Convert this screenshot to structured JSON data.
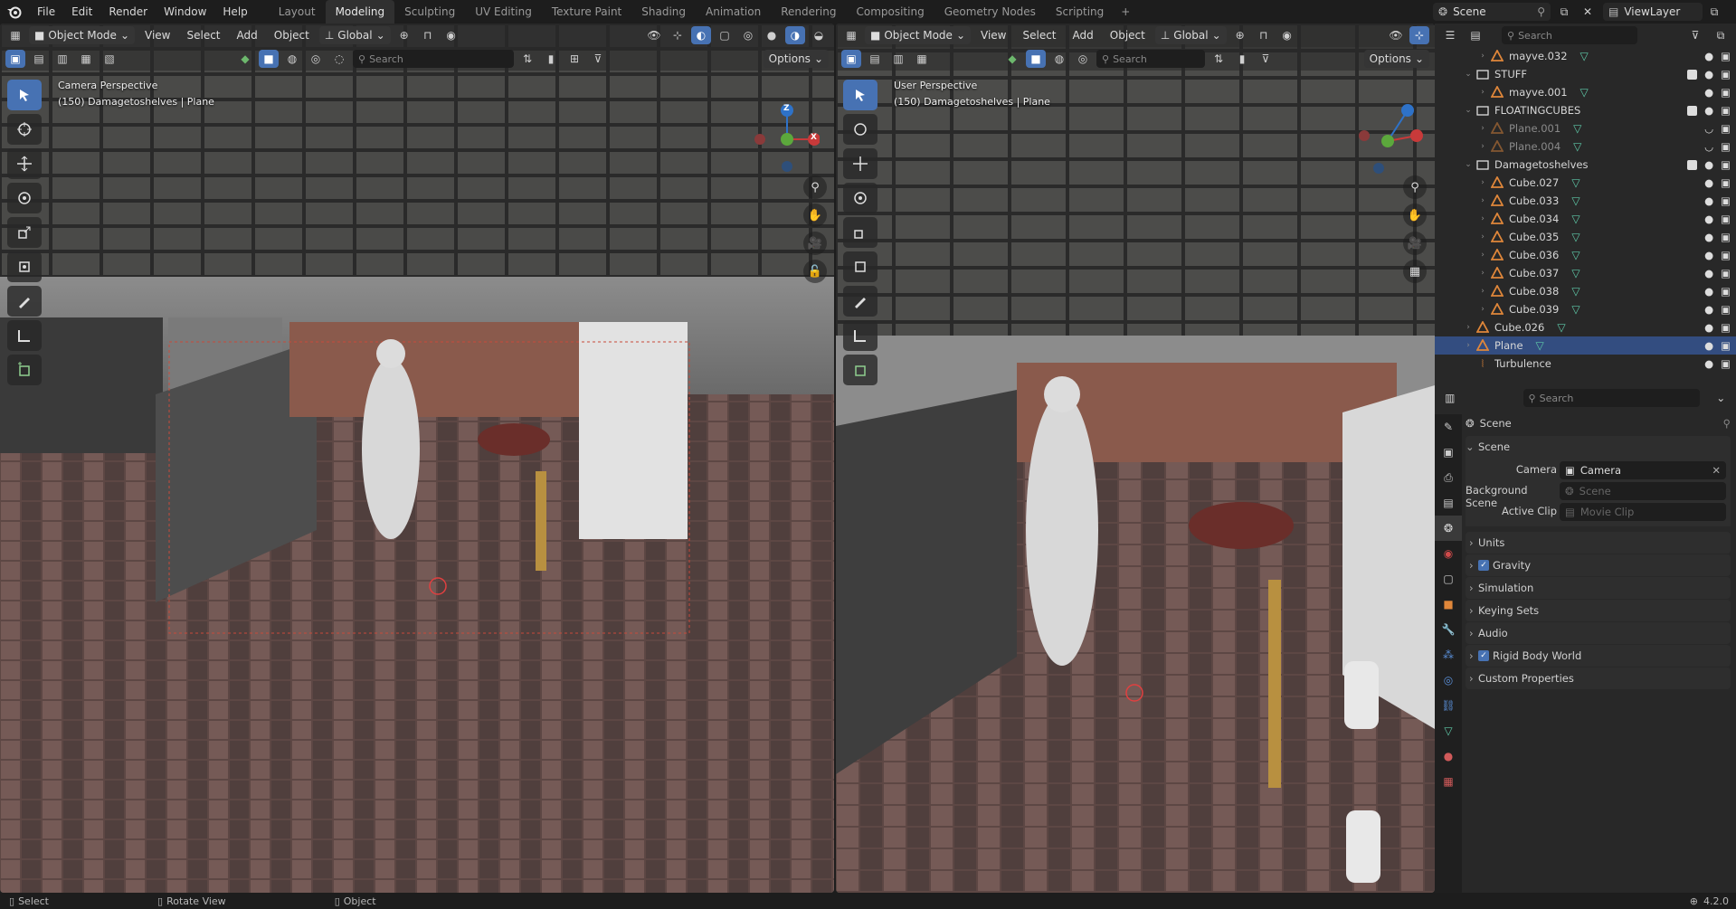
{
  "menus": {
    "file": "File",
    "edit": "Edit",
    "render": "Render",
    "window": "Window",
    "help": "Help"
  },
  "workspaces": [
    "Layout",
    "Modeling",
    "Sculpting",
    "UV Editing",
    "Texture Paint",
    "Shading",
    "Animation",
    "Rendering",
    "Compositing",
    "Geometry Nodes",
    "Scripting"
  ],
  "workspace_active": "Modeling",
  "scene_name": "Scene",
  "view_layer": "ViewLayer",
  "viewport_left": {
    "mode": "Object Mode",
    "menus": [
      "View",
      "Select",
      "Add",
      "Object"
    ],
    "orientation": "Global",
    "search_placeholder": "Search",
    "options": "Options",
    "info_title": "Camera Perspective",
    "info_sub": "(150) Damagetoshelves | Plane"
  },
  "viewport_right": {
    "mode": "Object Mode",
    "menus": [
      "View",
      "Select",
      "Add",
      "Object"
    ],
    "orientation": "Global",
    "search_placeholder": "Search",
    "options": "Options",
    "info_title": "User Perspective",
    "info_sub": "(150) Damagetoshelves | Plane"
  },
  "gizmo": {
    "x": "X",
    "y": "Y",
    "z": "Z"
  },
  "outliner": {
    "search_placeholder": "Search",
    "rows": [
      {
        "name": "mayve.032",
        "indent": 2,
        "type": "mesh",
        "arrow": "›"
      },
      {
        "name": "STUFF",
        "indent": 1,
        "type": "collection",
        "arrow": "⌄"
      },
      {
        "name": "mayve.001",
        "indent": 2,
        "type": "mesh",
        "arrow": "›"
      },
      {
        "name": "FLOATINGCUBES",
        "indent": 1,
        "type": "collection",
        "arrow": "⌄"
      },
      {
        "name": "Plane.001",
        "indent": 2,
        "type": "mesh-dim",
        "arrow": "›"
      },
      {
        "name": "Plane.004",
        "indent": 2,
        "type": "mesh-dim",
        "arrow": "›"
      },
      {
        "name": "Damagetoshelves",
        "indent": 1,
        "type": "collection",
        "arrow": "⌄"
      },
      {
        "name": "Cube.027",
        "indent": 2,
        "type": "mesh",
        "arrow": "›"
      },
      {
        "name": "Cube.033",
        "indent": 2,
        "type": "mesh",
        "arrow": "›"
      },
      {
        "name": "Cube.034",
        "indent": 2,
        "type": "mesh",
        "arrow": "›"
      },
      {
        "name": "Cube.035",
        "indent": 2,
        "type": "mesh",
        "arrow": "›"
      },
      {
        "name": "Cube.036",
        "indent": 2,
        "type": "mesh",
        "arrow": "›"
      },
      {
        "name": "Cube.037",
        "indent": 2,
        "type": "mesh",
        "arrow": "›"
      },
      {
        "name": "Cube.038",
        "indent": 2,
        "type": "mesh",
        "arrow": "›"
      },
      {
        "name": "Cube.039",
        "indent": 2,
        "type": "mesh",
        "arrow": "›"
      },
      {
        "name": "Cube.026",
        "indent": 1,
        "type": "mesh",
        "arrow": "›"
      },
      {
        "name": "Plane",
        "indent": 1,
        "type": "mesh",
        "arrow": "›",
        "selected": true
      },
      {
        "name": "Turbulence",
        "indent": 1,
        "type": "force",
        "arrow": ""
      }
    ]
  },
  "properties": {
    "search_placeholder": "Search",
    "context_title": "Scene",
    "section": "Scene",
    "camera_label": "Camera",
    "camera_value": "Camera",
    "background_label": "Background Scene",
    "background_placeholder": "Scene",
    "clip_label": "Active Clip",
    "clip_placeholder": "Movie Clip",
    "panels": [
      {
        "label": "Units",
        "checkbox": false
      },
      {
        "label": "Gravity",
        "checkbox": true
      },
      {
        "label": "Simulation",
        "checkbox": false
      },
      {
        "label": "Keying Sets",
        "checkbox": false
      },
      {
        "label": "Audio",
        "checkbox": false
      },
      {
        "label": "Rigid Body World",
        "checkbox": true
      },
      {
        "label": "Custom Properties",
        "checkbox": false
      }
    ]
  },
  "status": {
    "select": "Select",
    "rotate": "Rotate View",
    "object": "Object",
    "version": "4.2.0"
  },
  "colors": {
    "accent": "#4772b3",
    "mesh": "#e0873a",
    "vertex": "#5fc9a8",
    "selected_row": "#334d80"
  }
}
